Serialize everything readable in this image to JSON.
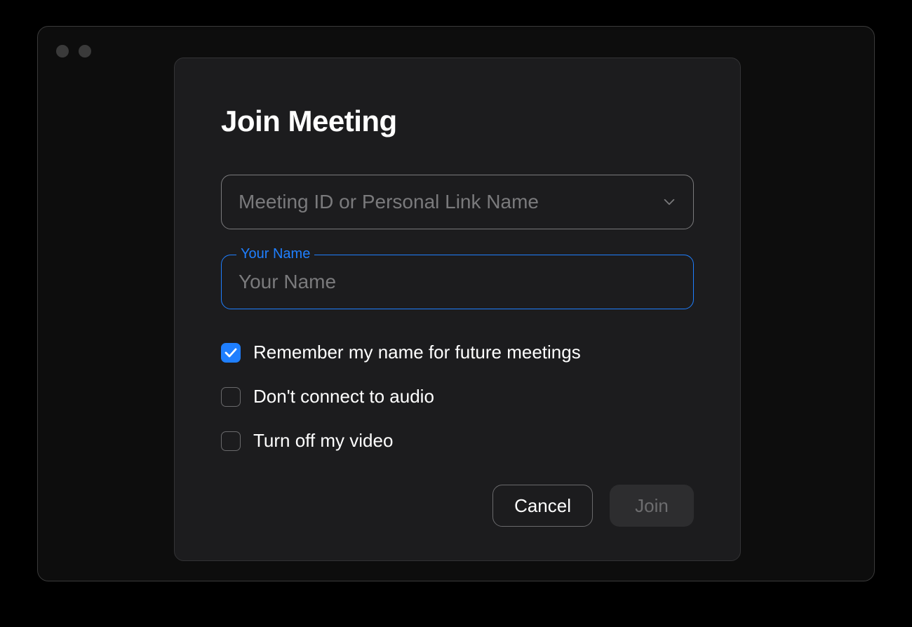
{
  "dialog": {
    "title": "Join Meeting",
    "meeting_id_placeholder": "Meeting ID or Personal Link Name",
    "name_float_label": "Your Name",
    "name_placeholder": "Your Name",
    "name_value": "",
    "checkboxes": {
      "remember": {
        "label": "Remember my name for future meetings",
        "checked": true
      },
      "no_audio": {
        "label": "Don't connect to audio",
        "checked": false
      },
      "no_video": {
        "label": "Turn off my video",
        "checked": false
      }
    },
    "buttons": {
      "cancel": "Cancel",
      "join": "Join"
    }
  }
}
